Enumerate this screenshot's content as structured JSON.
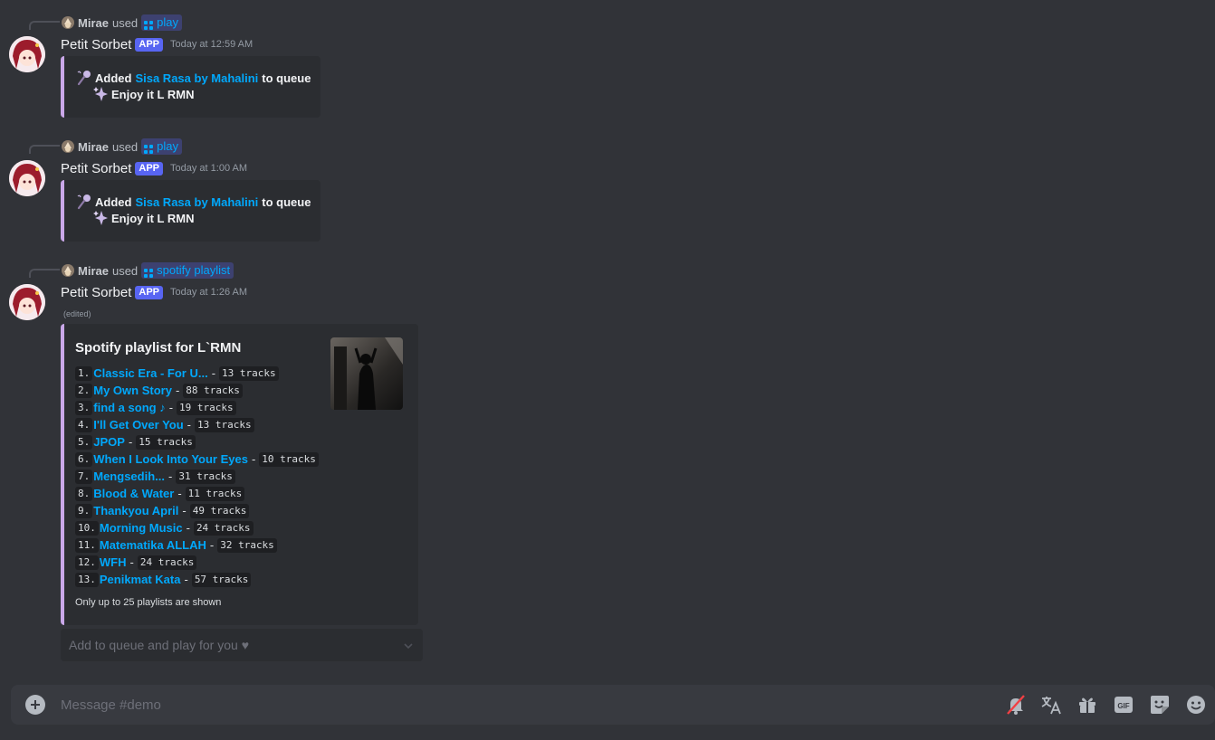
{
  "channel": {
    "composer_placeholder": "Message #demo"
  },
  "messages": [
    {
      "reply_user": "Mirae",
      "reply_used_text": "used",
      "command": "play",
      "author": "Petit Sorbet",
      "app_tag": "APP",
      "timestamp": "Today at 12:59 AM",
      "embed": {
        "added_prefix": "Added",
        "song_link": "Sisa Rasa by Mahalini",
        "added_suffix": "to queue",
        "enjoy_text": "Enjoy it L RMN"
      }
    },
    {
      "reply_user": "Mirae",
      "reply_used_text": "used",
      "command": "play",
      "author": "Petit Sorbet",
      "app_tag": "APP",
      "timestamp": "Today at 1:00 AM",
      "embed": {
        "added_prefix": "Added",
        "song_link": "Sisa Rasa by Mahalini",
        "added_suffix": "to queue",
        "enjoy_text": "Enjoy it L RMN"
      }
    },
    {
      "reply_user": "Mirae",
      "reply_used_text": "used",
      "command": "spotify playlist",
      "author": "Petit Sorbet",
      "app_tag": "APP",
      "timestamp": "Today at 1:26 AM",
      "edited": "(edited)",
      "embed": {
        "title": "Spotify playlist for L`RMN",
        "footer_note": "Only up to 25 playlists are shown",
        "playlists": [
          {
            "num": "1.",
            "name": "Classic Era - For U...",
            "tracks": "13 tracks"
          },
          {
            "num": "2.",
            "name": "My Own Story",
            "tracks": "88 tracks"
          },
          {
            "num": "3.",
            "name": "find a song ♪",
            "tracks": "19 tracks"
          },
          {
            "num": "4.",
            "name": "I'll Get Over You",
            "tracks": "13 tracks"
          },
          {
            "num": "5.",
            "name": "JPOP",
            "tracks": "15 tracks"
          },
          {
            "num": "6.",
            "name": "When I Look Into Your Eyes",
            "tracks": "10 tracks"
          },
          {
            "num": "7.",
            "name": "Mengsedih...",
            "tracks": "31 tracks"
          },
          {
            "num": "8.",
            "name": "Blood & Water",
            "tracks": "11 tracks"
          },
          {
            "num": "9.",
            "name": "Thankyou April",
            "tracks": "49 tracks"
          },
          {
            "num": "10.",
            "name": "Morning Music",
            "tracks": "24 tracks"
          },
          {
            "num": "11.",
            "name": "Matematika ALLAH",
            "tracks": "32 tracks"
          },
          {
            "num": "12.",
            "name": "WFH",
            "tracks": "24 tracks"
          },
          {
            "num": "13.",
            "name": "Penikmat Kata",
            "tracks": "57 tracks"
          }
        ]
      },
      "select_placeholder": "Add to queue and play for you ♥"
    }
  ],
  "icons": {
    "composer_left": "plus-circle-icon",
    "composer_right": [
      "mute-icon",
      "translate-icon",
      "gift-icon",
      "gif-icon",
      "sticker-icon",
      "emoji-icon"
    ],
    "gif_label": "GIF"
  },
  "colors": {
    "accent": "#5865f2",
    "link": "#00a8fc",
    "embed_border": "#c9a7e8"
  }
}
